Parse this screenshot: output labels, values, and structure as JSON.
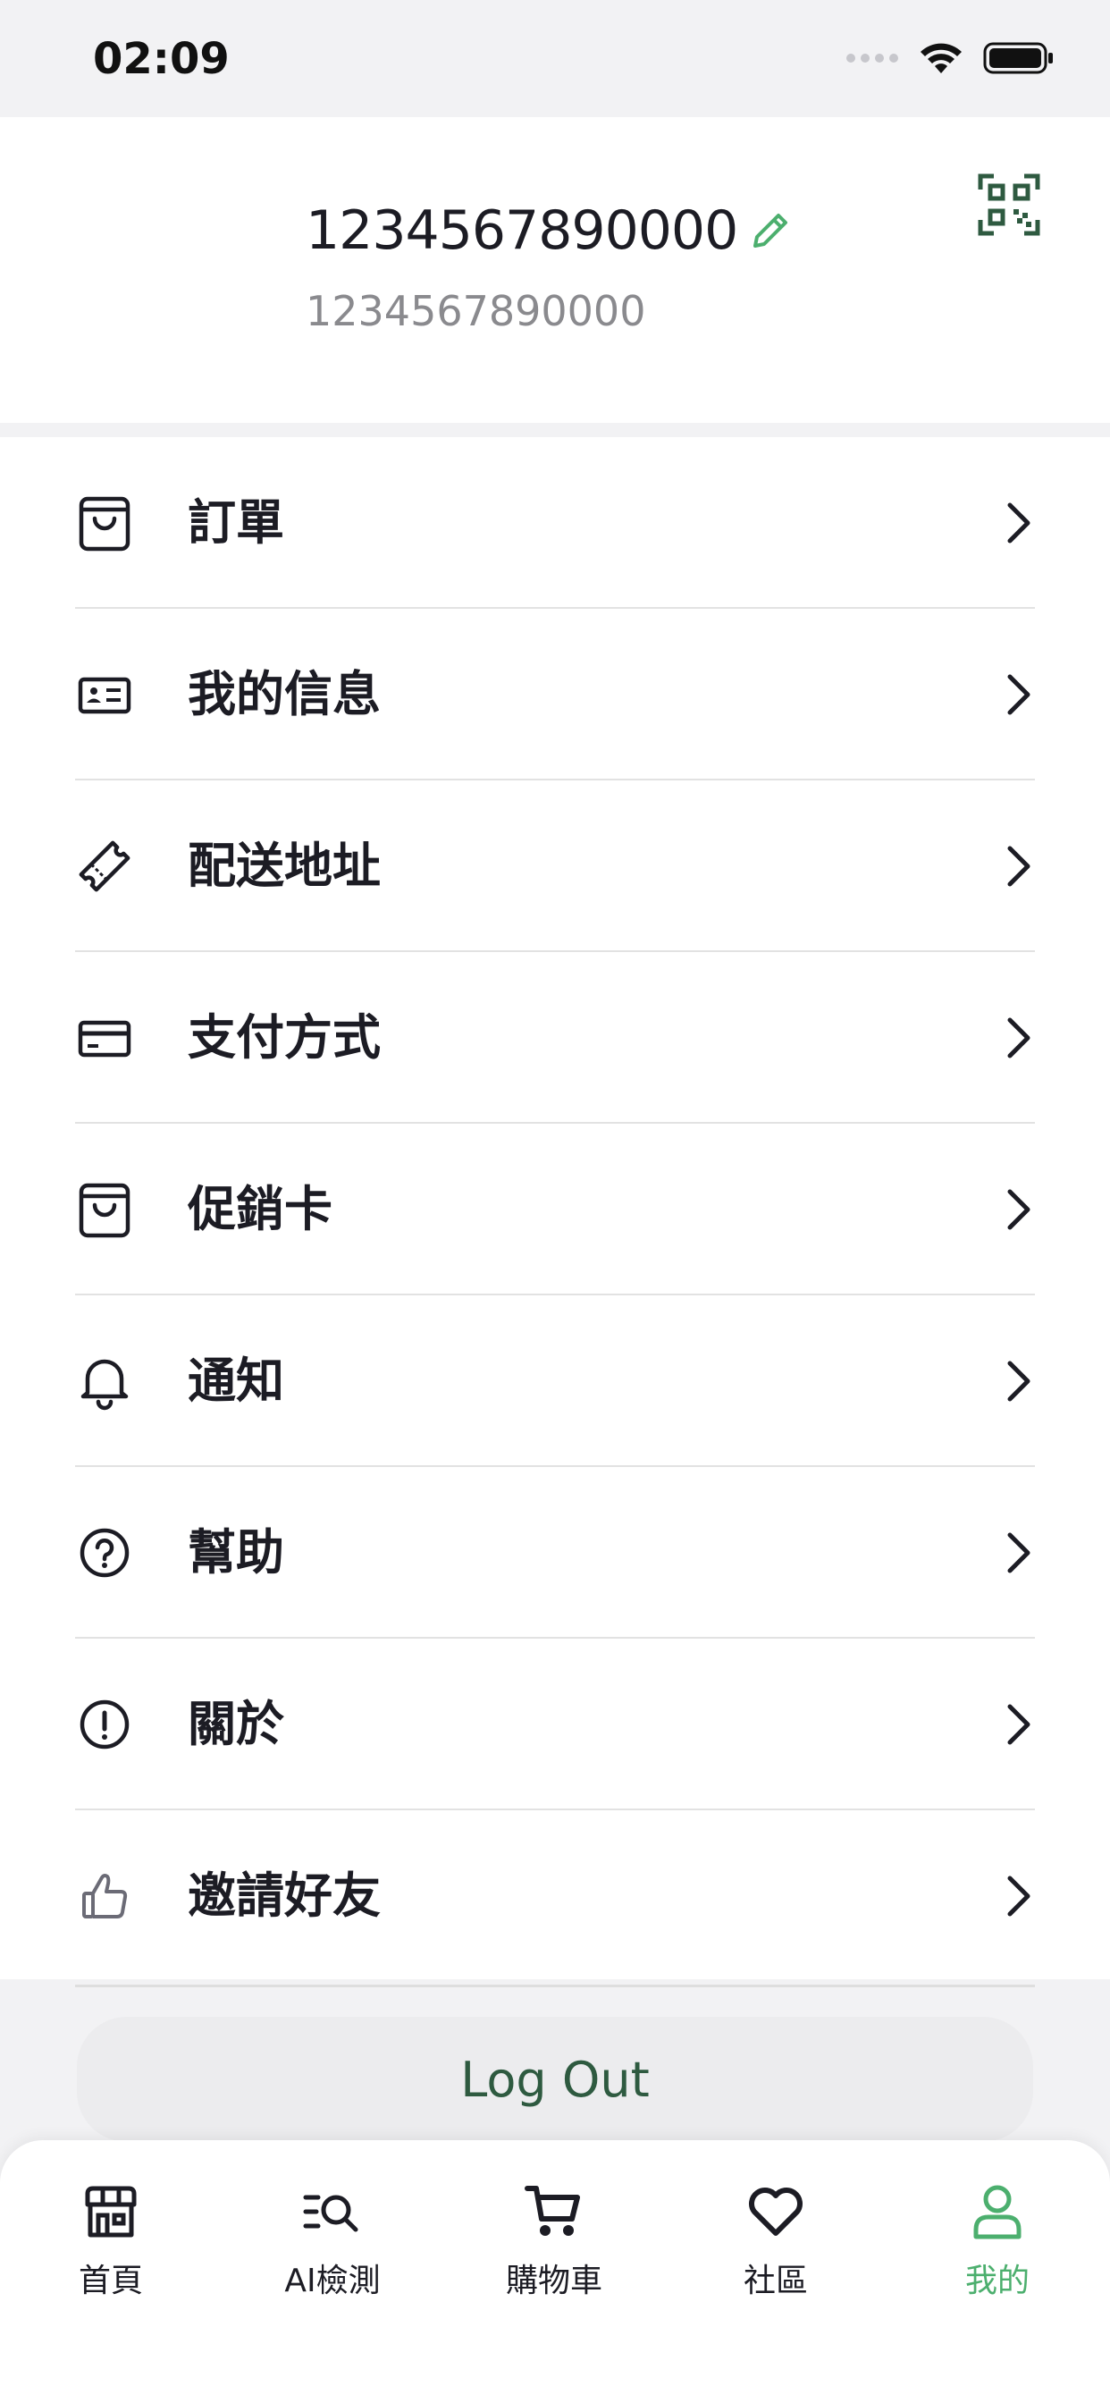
{
  "status_bar": {
    "time": "02:09"
  },
  "profile": {
    "name": "1234567890000",
    "subtitle": "1234567890000"
  },
  "menu": {
    "items": [
      {
        "label": "訂單",
        "icon": "shopping-bag-icon"
      },
      {
        "label": "我的信息",
        "icon": "id-card-icon"
      },
      {
        "label": "配送地址",
        "icon": "ticket-icon"
      },
      {
        "label": "支付方式",
        "icon": "credit-card-icon"
      },
      {
        "label": "促銷卡",
        "icon": "shopping-bag-icon"
      },
      {
        "label": "通知",
        "icon": "bell-icon"
      },
      {
        "label": "幫助",
        "icon": "question-circle-icon"
      },
      {
        "label": "關於",
        "icon": "info-circle-icon"
      },
      {
        "label": "邀請好友",
        "icon": "thumbs-up-icon"
      }
    ]
  },
  "logout": {
    "label": "Log Out"
  },
  "tabbar": {
    "tabs": [
      {
        "label": "首頁",
        "icon": "store-icon"
      },
      {
        "label": "AI檢測",
        "icon": "list-search-icon"
      },
      {
        "label": "購物車",
        "icon": "cart-icon"
      },
      {
        "label": "社區",
        "icon": "heart-icon"
      },
      {
        "label": "我的",
        "icon": "user-icon"
      }
    ],
    "active_index": 4
  },
  "colors": {
    "accent": "#4caf6e",
    "logout_text": "#2e5a40",
    "background": "#f2f2f4",
    "qr": "#2e5a40"
  }
}
